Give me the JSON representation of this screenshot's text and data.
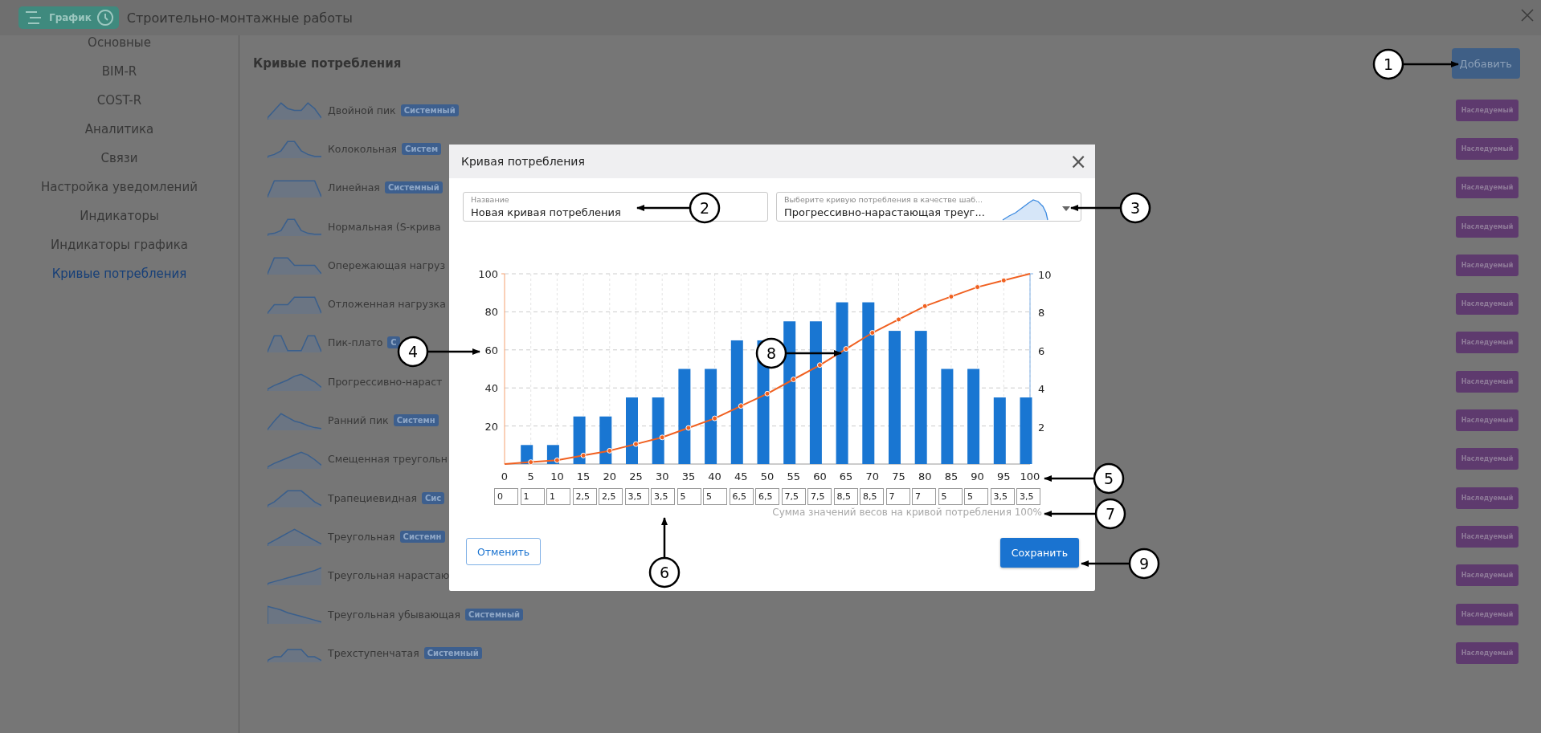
{
  "header": {
    "logo_label": "График",
    "title": "Строительно-монтажные работы"
  },
  "sidebar": {
    "items": [
      {
        "label": "Основные",
        "selected": false
      },
      {
        "label": "BIM-R",
        "selected": false
      },
      {
        "label": "COST-R",
        "selected": false
      },
      {
        "label": "Аналитика",
        "selected": false
      },
      {
        "label": "Связи",
        "selected": false
      },
      {
        "label": "Настройка уведомлений",
        "selected": false
      },
      {
        "label": "Индикаторы",
        "selected": false
      },
      {
        "label": "Индикаторы графика",
        "selected": false
      },
      {
        "label": "Кривые потребления",
        "selected": true
      }
    ]
  },
  "main": {
    "heading": "Кривые потребления",
    "add_button": "Добавить",
    "curves": [
      {
        "name": "Двойной пик",
        "badge": "Системный",
        "tag": "Наследуемый"
      },
      {
        "name": "Колокольная",
        "badge": "Систем",
        "tag": "Наследуемый"
      },
      {
        "name": "Линейная",
        "badge": "Системный",
        "tag": "Наследуемый"
      },
      {
        "name": "Нормальная (S-крива",
        "tag": "Наследуемый"
      },
      {
        "name": "Опережающая нагруз",
        "tag": "Наследуемый"
      },
      {
        "name": "Отложенная нагрузка",
        "tag": "Наследуемый"
      },
      {
        "name": "Пик-плато",
        "badge": "С",
        "tag": "Наследуемый"
      },
      {
        "name": "Прогрессивно-нараст",
        "tag": "Наследуемый"
      },
      {
        "name": "Ранний пик",
        "badge": "Системн",
        "tag": "Наследуемый"
      },
      {
        "name": "Смещенная треугольн",
        "tag": "Наследуемый"
      },
      {
        "name": "Трапециевидная",
        "badge": "Сис",
        "tag": "Наследуемый"
      },
      {
        "name": "Треугольная",
        "badge": "Системн",
        "tag": "Наследуемый"
      },
      {
        "name": "Треугольная нарастаю",
        "tag": "Наследуемый"
      },
      {
        "name": "Треугольная убывающая",
        "badge": "Системный",
        "tag": "Наследуемый"
      },
      {
        "name": "Трехступенчатая",
        "badge": "Системный",
        "tag": "Наследуемый"
      }
    ]
  },
  "dialog": {
    "title": "Кривая потребления",
    "close": "×",
    "name_field": {
      "label": "Название",
      "value": "Новая кривая потребления"
    },
    "template_field": {
      "label": "Выберите кривую потребления в качестве шаб...",
      "value": "Прогрессивно-нарастающая треуг..."
    },
    "chart_data": {
      "type": "bar",
      "categories": [
        "0",
        "5",
        "10",
        "15",
        "20",
        "25",
        "30",
        "35",
        "40",
        "45",
        "50",
        "55",
        "60",
        "65",
        "70",
        "75",
        "80",
        "85",
        "90",
        "95",
        "100"
      ],
      "grid": true,
      "ylim": [
        0,
        100
      ],
      "yticks": [
        20,
        40,
        60,
        80,
        100
      ],
      "y2lim": [
        0,
        10
      ],
      "y2ticks": [
        2,
        4,
        6,
        8,
        10
      ],
      "series": [
        {
          "axis": "y2",
          "color": "#1976d2",
          "values": [
            0,
            1,
            1,
            2.5,
            2.5,
            3.5,
            3.5,
            5,
            5,
            6.5,
            6.5,
            7.5,
            7.5,
            8.5,
            8.5,
            7,
            7,
            5,
            5,
            3.5,
            3.5
          ]
        },
        {
          "type": "line",
          "marker": "circle",
          "color": "#f06020",
          "values": [
            0,
            1,
            2,
            4.5,
            7,
            10.5,
            14,
            19,
            24,
            30.5,
            37,
            44.5,
            52,
            60.5,
            69,
            76,
            83,
            88,
            93,
            96.5,
            100
          ]
        }
      ]
    },
    "weights": [
      "0",
      "1",
      "1",
      "2,5",
      "2,5",
      "3,5",
      "3,5",
      "5",
      "5",
      "6,5",
      "6,5",
      "7,5",
      "7,5",
      "8,5",
      "8,5",
      "7",
      "7",
      "5",
      "5",
      "3,5",
      "3,5"
    ],
    "sum_note": "Сумма значений весов на кривой потребления 100%",
    "cancel_button": "Отменить",
    "save_button": "Сохранить"
  },
  "callouts": [
    {
      "number": "1"
    },
    {
      "number": "2"
    },
    {
      "number": "3"
    },
    {
      "number": "4"
    },
    {
      "number": "5"
    },
    {
      "number": "6"
    },
    {
      "number": "7"
    },
    {
      "number": "8"
    },
    {
      "number": "9"
    }
  ]
}
